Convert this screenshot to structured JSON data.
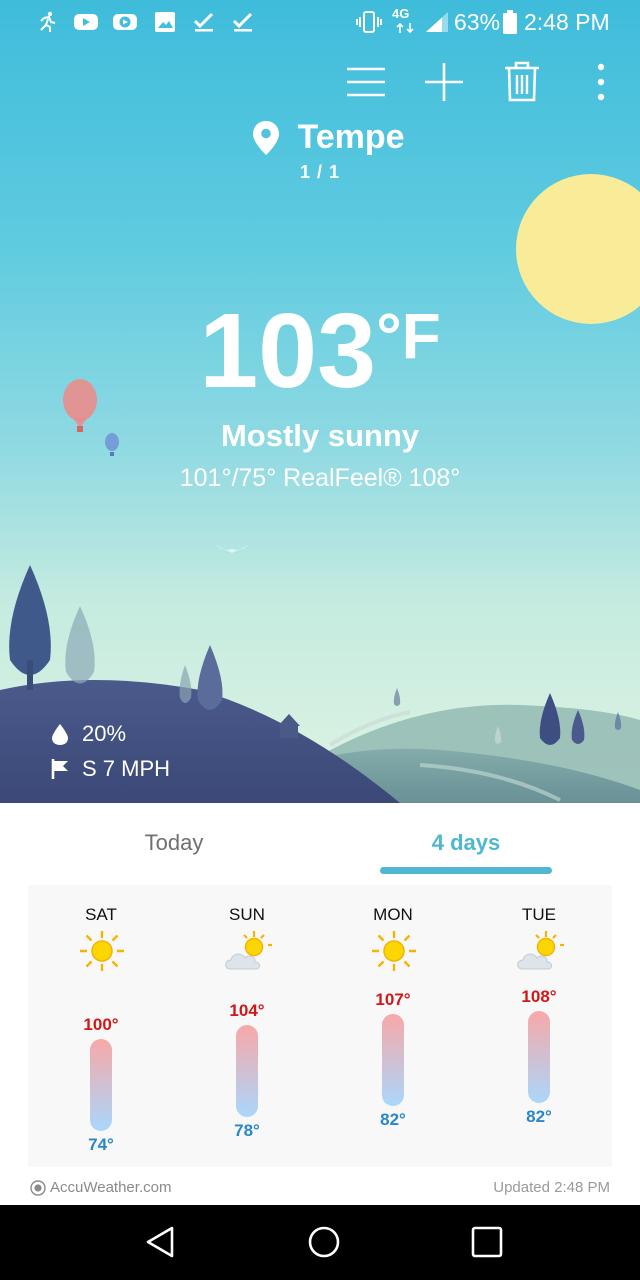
{
  "status_bar": {
    "network": "4G",
    "battery": "63%",
    "time": "2:48 PM",
    "notification_icons": [
      "run-icon",
      "youtube-icon",
      "play-icon",
      "image-icon",
      "check-icon",
      "check-icon"
    ]
  },
  "toolbar": {
    "icons": [
      "menu-icon",
      "add-icon",
      "trash-icon",
      "more-icon"
    ]
  },
  "location": {
    "city": "Tempe",
    "page": "1 / 1"
  },
  "current": {
    "temperature": "103",
    "unit": "°F",
    "condition": "Mostly sunny",
    "details": "101°/75° RealFeel® 108°",
    "precipitation": "20%",
    "wind": "S 7 MPH"
  },
  "tabs": [
    {
      "label": "Today",
      "active": false
    },
    {
      "label": "4 days",
      "active": true
    }
  ],
  "forecast": [
    {
      "day": "SAT",
      "icon": "sun-icon",
      "high": "100°",
      "low": "74°",
      "high_value": 100,
      "low_value": 74
    },
    {
      "day": "SUN",
      "icon": "partly-cloudy-icon",
      "high": "104°",
      "low": "78°",
      "high_value": 104,
      "low_value": 78
    },
    {
      "day": "MON",
      "icon": "sun-icon",
      "high": "107°",
      "low": "82°",
      "high_value": 107,
      "low_value": 82
    },
    {
      "day": "TUE",
      "icon": "partly-cloudy-icon",
      "high": "108°",
      "low": "82°",
      "high_value": 108,
      "low_value": 82
    }
  ],
  "footer": {
    "source": "AccuWeather.com",
    "updated": "Updated 2:48 PM"
  },
  "colors": {
    "accent": "#4fb8d0",
    "high_temp": "#d01818",
    "low_temp": "#2a86c8"
  }
}
